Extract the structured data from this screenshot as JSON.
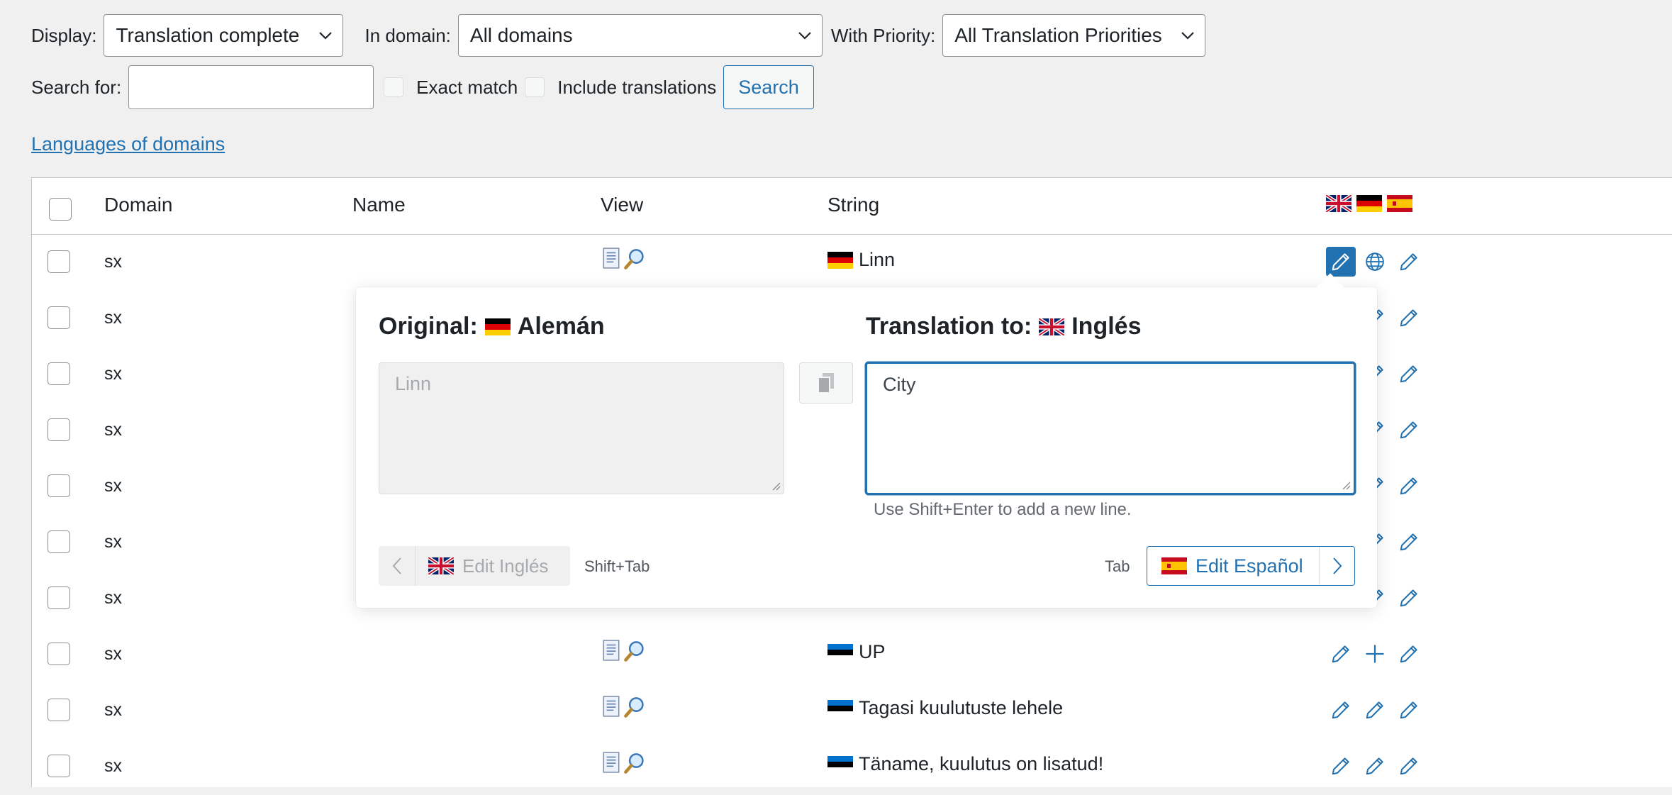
{
  "filters": {
    "display_label": "Display:",
    "display_value": "Translation complete",
    "domain_label": "In domain:",
    "domain_value": "All domains",
    "priority_label": "With Priority:",
    "priority_value": "All Translation Priorities",
    "search_label": "Search for:",
    "search_value": "",
    "exact_match_label": "Exact match",
    "include_translations_label": "Include translations",
    "search_button": "Search"
  },
  "languages_link": "Languages of domains",
  "table": {
    "columns": {
      "domain": "Domain",
      "name": "Name",
      "view": "View",
      "string": "String"
    },
    "header_flags": [
      "en",
      "de",
      "es"
    ],
    "rows": [
      {
        "domain": "sx",
        "string": "Linn",
        "flag": "de",
        "actions": [
          "pencil-active",
          "globe",
          "pencil"
        ],
        "view": true
      },
      {
        "domain": "sx",
        "string": "",
        "flag": "",
        "actions": [
          "pencil",
          "pencil"
        ],
        "view": false
      },
      {
        "domain": "sx",
        "string": "",
        "flag": "",
        "actions": [
          "pencil",
          "pencil"
        ],
        "view": false
      },
      {
        "domain": "sx",
        "string": "",
        "flag": "",
        "actions": [
          "pencil",
          "pencil"
        ],
        "view": false
      },
      {
        "domain": "sx",
        "string": "",
        "flag": "",
        "actions": [
          "pencil",
          "pencil"
        ],
        "view": false
      },
      {
        "domain": "sx",
        "string": "",
        "flag": "",
        "actions": [
          "pencil",
          "pencil"
        ],
        "view": false
      },
      {
        "domain": "sx",
        "string": "",
        "flag": "",
        "actions": [
          "pencil",
          "pencil"
        ],
        "view": false
      },
      {
        "domain": "sx",
        "string": "UP",
        "flag": "ee",
        "actions": [
          "pencil",
          "plus",
          "pencil"
        ],
        "view": true
      },
      {
        "domain": "sx",
        "string": "Tagasi kuulutuste lehele",
        "flag": "ee",
        "actions": [
          "pencil",
          "pencil",
          "pencil"
        ],
        "view": true
      },
      {
        "domain": "sx",
        "string": "Täname, kuulutus on lisatud!",
        "flag": "ee",
        "actions": [
          "pencil",
          "pencil",
          "pencil"
        ],
        "view": true
      }
    ]
  },
  "popup": {
    "original_label": "Original:",
    "original_language": "Alemán",
    "original_text": "Linn",
    "translation_label": "Translation to:",
    "translation_language": "Inglés",
    "translation_text": "City",
    "hint": "Use Shift+Enter to add a new line.",
    "prev_label": "Edit Inglés",
    "prev_shortcut": "Shift+Tab",
    "next_shortcut": "Tab",
    "next_label": "Edit Español"
  },
  "colors": {
    "accent": "#2271b1",
    "text": "#1d2327",
    "muted": "#646970",
    "background": "#f0f0f1"
  }
}
